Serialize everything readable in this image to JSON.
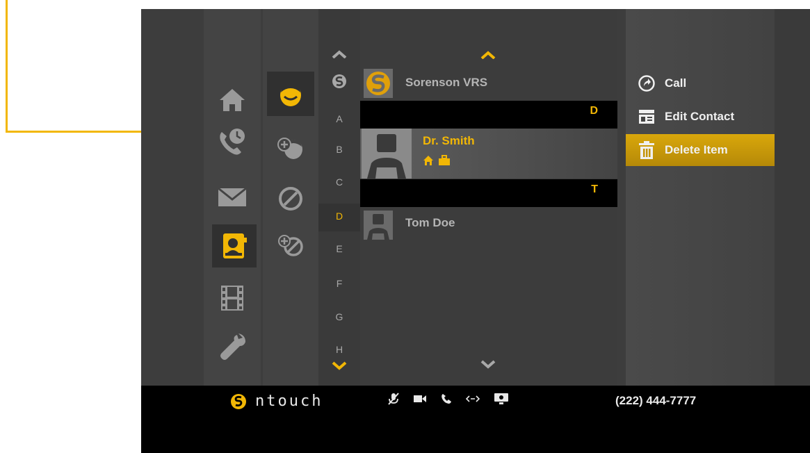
{
  "nav": {
    "items": [
      "home-icon",
      "call-history-icon",
      "messages-icon",
      "contacts-icon",
      "video-center-icon",
      "settings-icon"
    ],
    "selected": "contacts-icon"
  },
  "subnav": {
    "items": [
      "contact-person-icon",
      "add-contact-icon",
      "blocked-icon",
      "add-blocked-icon"
    ],
    "selected": "contact-person-icon"
  },
  "alpha": {
    "letters": [
      "A",
      "B",
      "C",
      "D",
      "E",
      "F",
      "G",
      "H"
    ],
    "selected": "D"
  },
  "contacts": {
    "sorenson": "Sorenson VRS",
    "header_d": "D",
    "selected_name": "Dr. Smith",
    "header_t": "T",
    "tom": "Tom Doe"
  },
  "menu": {
    "call": "Call",
    "edit": "Edit Contact",
    "delete": "Delete Item",
    "selected": "delete"
  },
  "footer": {
    "brand": "ntouch",
    "phone": "(222) 444-7777"
  },
  "colors": {
    "accent": "#f2b705",
    "bar": "#000000",
    "background": "#3d3d3d"
  }
}
